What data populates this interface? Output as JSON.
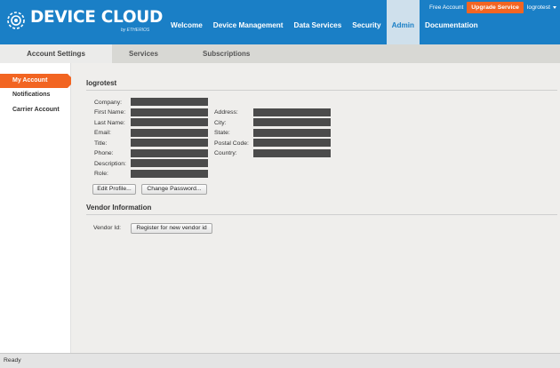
{
  "brand": {
    "name": "DEVICE CLOUD",
    "sub": "by ETHERIOS",
    "header_color": "#1a7fc6",
    "accent_color": "#f26522"
  },
  "nav": {
    "items": [
      "Welcome",
      "Device Management",
      "Data Services",
      "Security",
      "Admin",
      "Documentation"
    ],
    "active": "Admin"
  },
  "account_bar": {
    "plan": "Free Account",
    "upgrade_label": "Upgrade Service",
    "username": "logrotest"
  },
  "subnav": {
    "items": [
      "Account Settings",
      "Services",
      "Subscriptions"
    ],
    "active": "Account Settings"
  },
  "sidebar": {
    "items": [
      "My Account",
      "Notifications",
      "Carrier Account"
    ],
    "active": "My Account"
  },
  "account": {
    "heading": "logrotest",
    "left_fields": [
      {
        "label": "Company:",
        "value": ""
      },
      {
        "label": "First Name:",
        "value": ""
      },
      {
        "label": "Last Name:",
        "value": ""
      },
      {
        "label": "Email:",
        "value": ""
      },
      {
        "label": "Title:",
        "value": ""
      },
      {
        "label": "Phone:",
        "value": ""
      },
      {
        "label": "Description:",
        "value": ""
      },
      {
        "label": "Role:",
        "value": ""
      }
    ],
    "right_fields": [
      {
        "label": "Address:",
        "value": ""
      },
      {
        "label": "City:",
        "value": ""
      },
      {
        "label": "State:",
        "value": ""
      },
      {
        "label": "Postal Code:",
        "value": ""
      },
      {
        "label": "Country:",
        "value": ""
      }
    ],
    "edit_profile_label": "Edit Profile...",
    "change_password_label": "Change Password..."
  },
  "vendor": {
    "heading": "Vendor Information",
    "vendor_id_label": "Vendor Id:",
    "register_label": "Register for new vendor id"
  },
  "status": {
    "text": "Ready"
  }
}
